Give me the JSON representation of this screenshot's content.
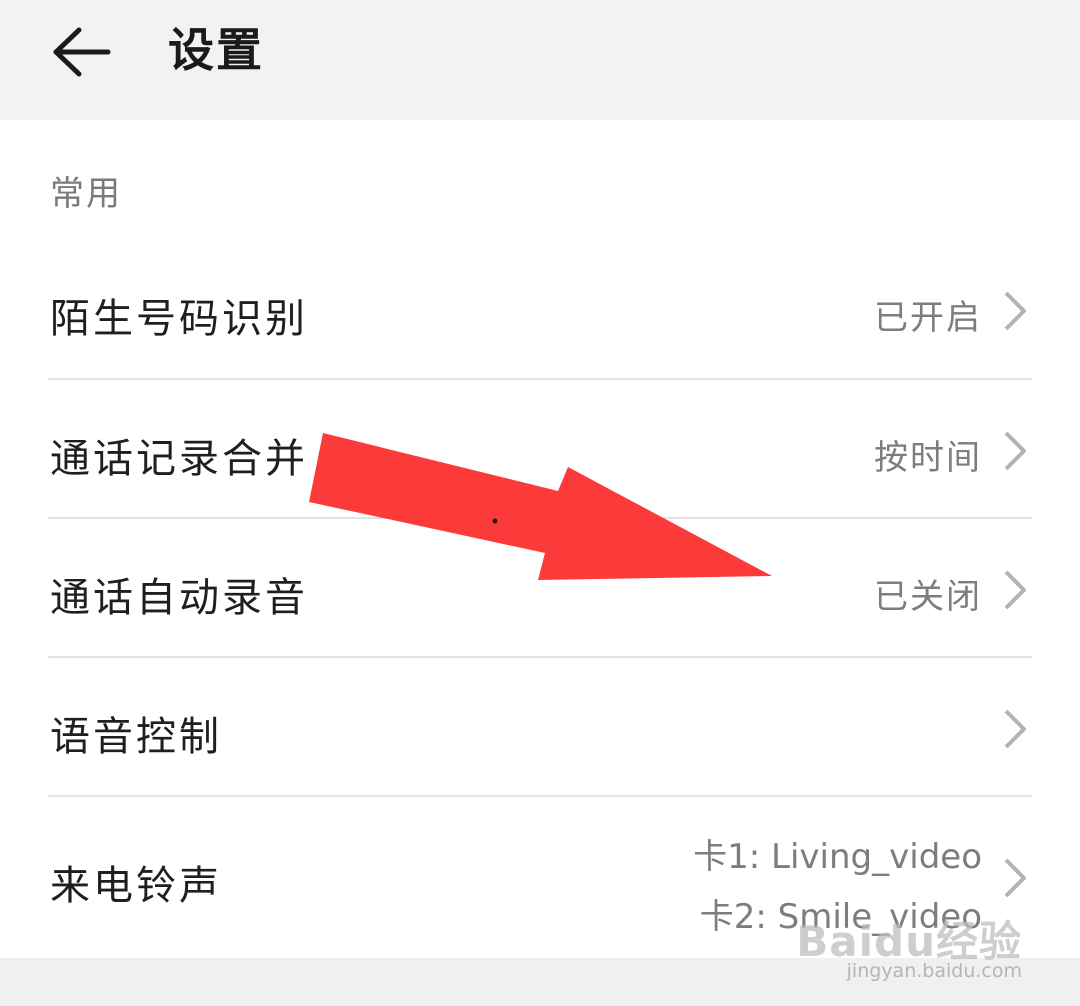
{
  "header": {
    "back_icon": "arrow-left-icon",
    "title": "设置"
  },
  "section": {
    "label": "常用"
  },
  "rows": [
    {
      "label": "陌生号码识别",
      "value": "已开启"
    },
    {
      "label": "通话记录合并",
      "value": "按时间"
    },
    {
      "label": "通话自动录音",
      "value": "已关闭"
    },
    {
      "label": "语音控制",
      "value": ""
    },
    {
      "label": "来电铃声",
      "values": [
        "卡1: Living_video",
        "卡2: Smile_video"
      ]
    }
  ],
  "watermark": {
    "main": "Baidu经验",
    "sub": "jingyan.baidu.com"
  },
  "colors": {
    "header_bg": "#f2f2f2",
    "annotation_arrow": "#fc3a3a",
    "secondary_text": "#7d7d7d"
  }
}
